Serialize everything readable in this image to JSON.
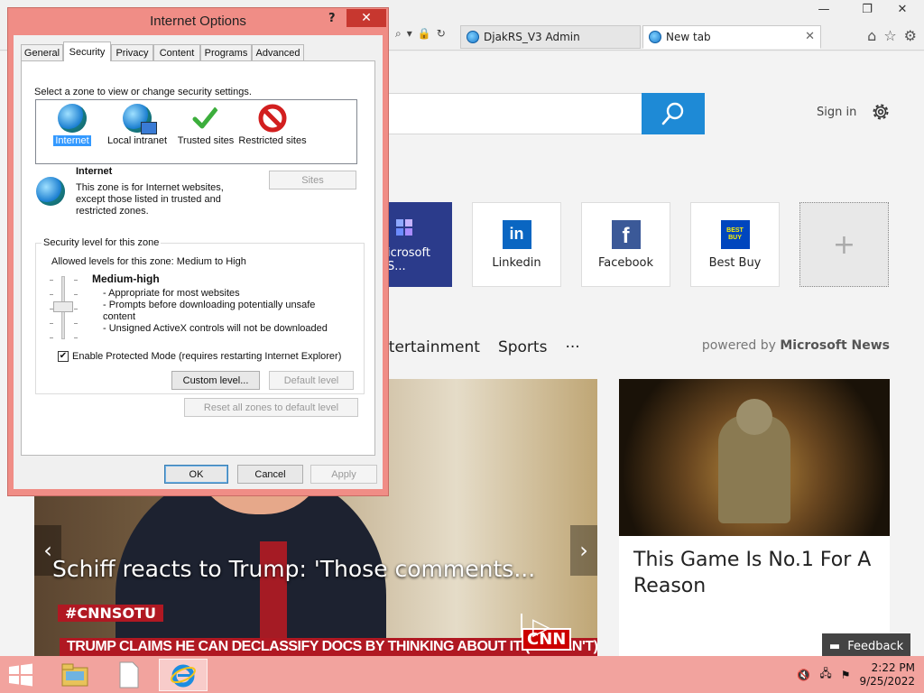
{
  "browser": {
    "tabs": [
      {
        "label": "DjakRS_V3 Admin"
      },
      {
        "label": "New tab"
      }
    ],
    "window_controls": {
      "minimize": "—",
      "restore": "❐",
      "close": "✕"
    }
  },
  "ntp": {
    "sign_in": "Sign in",
    "tiles": [
      {
        "label": "icrosoft S...",
        "color": "#2b3b8b"
      },
      {
        "label": "Linkedin",
        "color": "#0a66c2"
      },
      {
        "label": "Facebook",
        "color": "#3b5998"
      },
      {
        "label": "Best Buy",
        "color": "#0046be",
        "logo_text": "BEST BUY"
      }
    ],
    "add_tile": "+",
    "nav": [
      "ntertainment",
      "Sports",
      "···"
    ],
    "powered_by_prefix": "powered by",
    "powered_by_brand": "Microsoft News",
    "hero": {
      "title": "Schiff reacts to Trump: 'Those comments...",
      "tag": "#CNNSOTU",
      "banner": "TRUMP CLAIMS HE CAN DECLASSIFY DOCS BY THINKING ABOUT IT (HE CAN'T)",
      "network": "CNN"
    },
    "card": {
      "title": "This Game Is No.1 For A Reason"
    },
    "feedback": "Feedback"
  },
  "dialog": {
    "title": "Internet Options",
    "help": "?",
    "close": "✕",
    "tabs": [
      "General",
      "Security",
      "Privacy",
      "Content",
      "Programs",
      "Advanced"
    ],
    "active_tab": "Security",
    "zone_prompt": "Select a zone to view or change security settings.",
    "zones": [
      {
        "label": "Internet",
        "icon": "globe-icon",
        "selected": true
      },
      {
        "label": "Local intranet",
        "icon": "intranet-icon"
      },
      {
        "label": "Trusted sites",
        "icon": "checkmark-icon"
      },
      {
        "label": "Restricted sites",
        "icon": "restricted-icon"
      }
    ],
    "zone_detail": {
      "title": "Internet",
      "description": "This zone is for Internet websites, except those listed in trusted and restricted zones."
    },
    "sites_button": "Sites",
    "level_legend": "Security level for this zone",
    "allowed_levels": "Allowed levels for this zone: Medium to High",
    "level_name": "Medium-high",
    "level_bullets": [
      "- Appropriate for most websites",
      "- Prompts before downloading potentially unsafe",
      "content",
      "- Unsigned ActiveX controls will not be downloaded"
    ],
    "protected_mode": {
      "label": "Enable Protected Mode (requires restarting Internet Explorer)",
      "checked": true
    },
    "custom_level": "Custom level...",
    "default_level": "Default level",
    "reset_all": "Reset all zones to default level",
    "ok": "OK",
    "cancel": "Cancel",
    "apply": "Apply"
  },
  "taskbar": {
    "time": "2:22 PM",
    "date": "9/25/2022",
    "colors": {
      "bar": "#f2a39e",
      "accent": "#1e8ad6"
    }
  }
}
